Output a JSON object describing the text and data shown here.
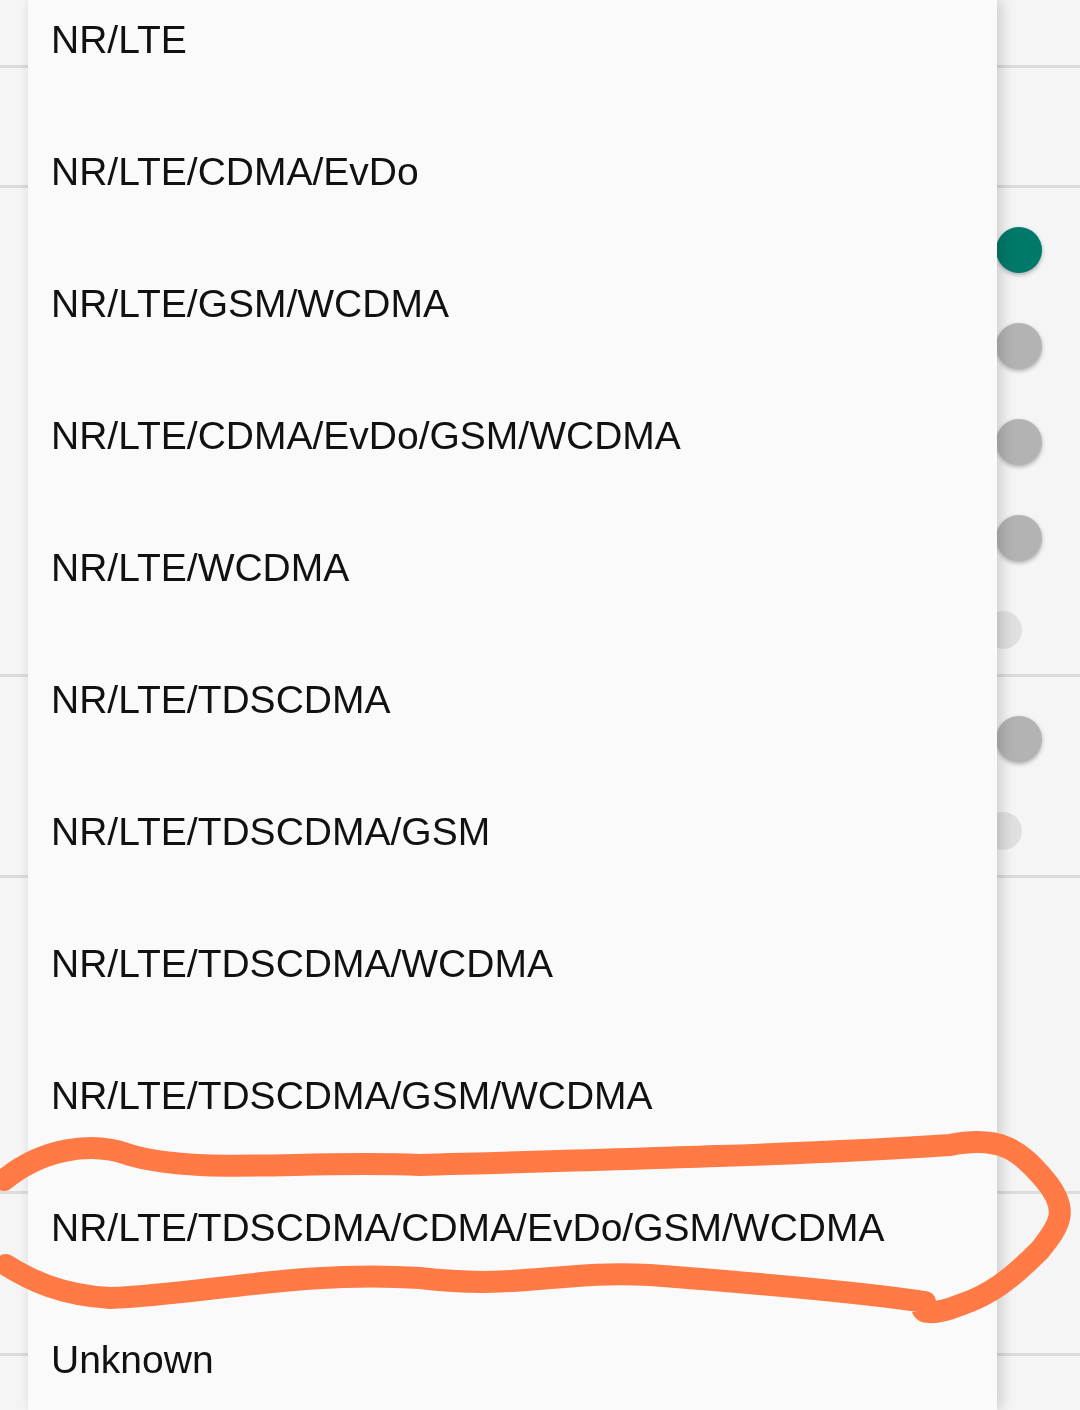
{
  "background": {
    "sections": [
      {
        "switches": [
          {
            "on": true,
            "disabled": false
          },
          {
            "on": false,
            "disabled": false
          },
          {
            "on": false,
            "disabled": false
          },
          {
            "on": false,
            "disabled": false
          },
          {
            "disabled": true
          }
        ]
      },
      {
        "switches": [
          {
            "on": false,
            "disabled": false
          },
          {
            "disabled": true
          }
        ]
      }
    ]
  },
  "options": [
    {
      "label": "NR/LTE",
      "circled": false
    },
    {
      "label": "NR/LTE/CDMA/EvDo",
      "circled": false
    },
    {
      "label": "NR/LTE/GSM/WCDMA",
      "circled": false
    },
    {
      "label": "NR/LTE/CDMA/EvDo/GSM/WCDMA",
      "circled": false
    },
    {
      "label": "NR/LTE/WCDMA",
      "circled": false
    },
    {
      "label": "NR/LTE/TDSCDMA",
      "circled": false
    },
    {
      "label": "NR/LTE/TDSCDMA/GSM",
      "circled": false
    },
    {
      "label": "NR/LTE/TDSCDMA/WCDMA",
      "circled": false
    },
    {
      "label": "NR/LTE/TDSCDMA/GSM/WCDMA",
      "circled": false
    },
    {
      "label": "NR/LTE/TDSCDMA/CDMA/EvDo/GSM/WCDMA",
      "circled": true
    },
    {
      "label": "Unknown",
      "circled": false
    }
  ]
}
